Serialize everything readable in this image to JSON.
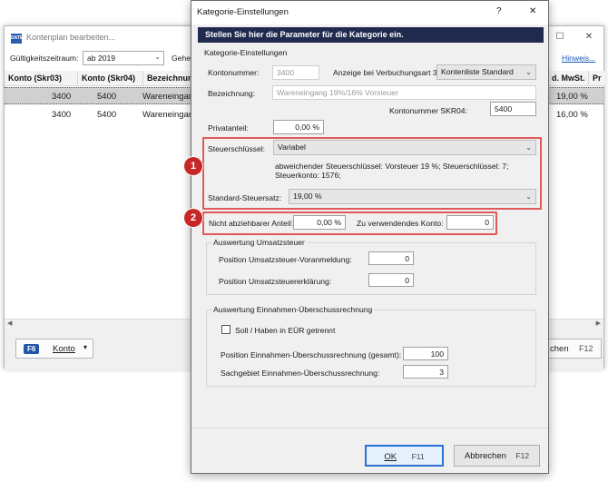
{
  "bg_window": {
    "title": "Kontenplan bearbeiten...",
    "app_icon": "DATEV",
    "filter_label": "Gültigkeitszeitraum:",
    "filter_value": "ab 2019",
    "filter_label2": "Gehe z",
    "hinweis_link": "Hinweis...",
    "columns": [
      "Konto (Skr03)",
      "Konto (Skr04)",
      "Bezeichnung",
      "d. MwSt.",
      "Pr"
    ],
    "rows": [
      {
        "skr03": "3400",
        "skr04": "5400",
        "name": "Wareneingan",
        "mwst": "19,00 %"
      },
      {
        "skr03": "3400",
        "skr04": "5400",
        "name": "Wareneingan",
        "mwst": "16,00 %"
      }
    ],
    "konto_button": {
      "key": "F6",
      "label": "Konto"
    },
    "right_button": {
      "label": "chen",
      "key": "F12"
    }
  },
  "dialog": {
    "title": "Kategorie-Einstellungen",
    "help": "?",
    "close": "✕",
    "banner": "Stellen Sie hier die Parameter für die Kategorie ein.",
    "section_title": "Kategorie-Einstellungen",
    "kontonummer_label": "Kontonummer:",
    "kontonummer_value": "3400",
    "anzeige_label": "Anzeige bei Verbuchungsart 3:",
    "anzeige_value": "Kontenliste Standard",
    "bezeichnung_label": "Bezeichnung:",
    "bezeichnung_value": "Wareneingang 19%/16% Vorsteuer",
    "skr04_label": "Kontonummer SKR04:",
    "skr04_value": "5400",
    "privat_label": "Privatanteil:",
    "privat_value": "0,00 %",
    "steuer_label": "Steuerschlüssel:",
    "steuer_value": "Variabel",
    "steuer_info1": "abweichender Steuerschlüssel: Vorsteuer 19 %; Steuerschlüssel: 7;",
    "steuer_info2": "Steuerkonto: 1576;",
    "satz_label": "Standard-Steuersatz:",
    "satz_value": "19,00 %",
    "nicht_label": "Nicht abziehbarer Anteil:",
    "nicht_value": "0,00 %",
    "zu_label": "Zu verwendendes Konto:",
    "zu_value": "0",
    "badge1": "1",
    "badge2": "2",
    "ust_group": "Auswertung Umsatzsteuer",
    "ust_vor_label": "Position Umsatzsteuer-Voranmeldung:",
    "ust_vor_value": "0",
    "ust_erk_label": "Position Umsatzsteuererklärung:",
    "ust_erk_value": "0",
    "eur_group": "Auswertung Einnahmen-Überschussrechnung",
    "soll_label": "Soll / Haben in EÜR getrennt",
    "pos_eur_label": "Position Einnahmen-Überschussrechnung (gesamt):",
    "pos_eur_value": "100",
    "sach_label": "Sachgebiet Einnahmen-Überschussrechnung:",
    "sach_value": "3",
    "ok_label": "OK",
    "ok_key": "F11",
    "cancel_label": "Abbrechen",
    "cancel_key": "F12"
  },
  "colors": {
    "banner": "#1f2a4e",
    "accent": "#2a72d4",
    "highlight": "#e05a5a",
    "badge": "#c62828"
  }
}
